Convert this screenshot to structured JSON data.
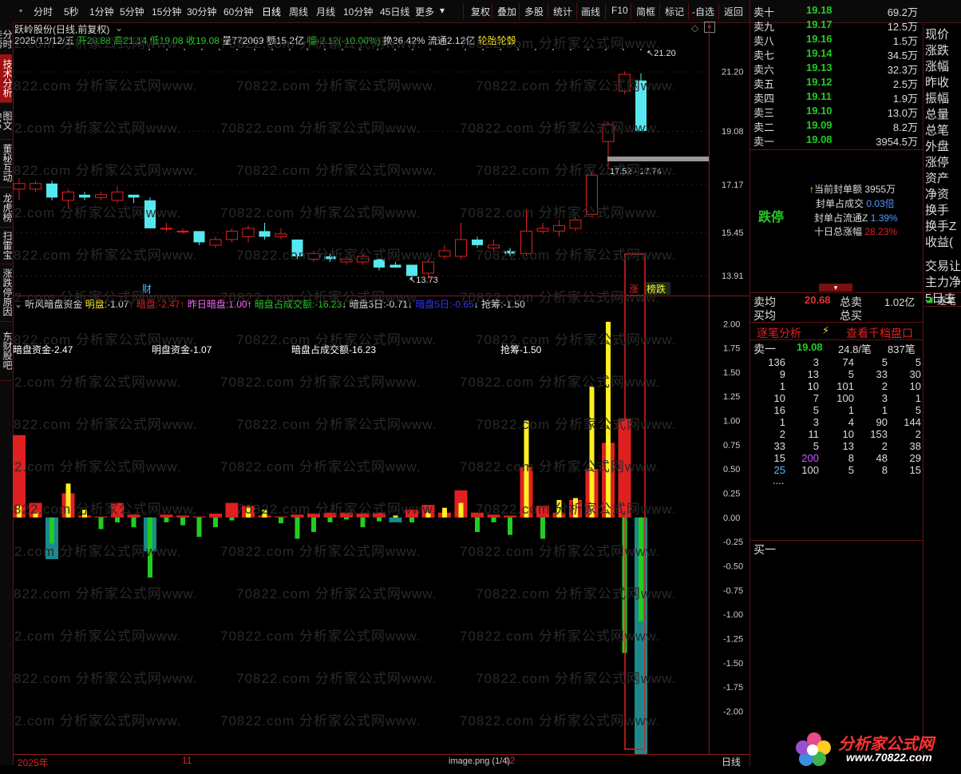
{
  "toolbar": {
    "items": [
      "分时",
      "5秒",
      "1分钟",
      "5分钟",
      "15分钟",
      "30分钟",
      "60分钟",
      "日线",
      "周线",
      "月线",
      "10分钟",
      "45日线",
      "更多"
    ],
    "right_items": [
      "复权",
      "叠加",
      "多股",
      "统计",
      "画线",
      "F10",
      "简框",
      "标记",
      "-自选",
      "返回"
    ]
  },
  "left_nav": [
    "分时走势",
    "技术分析",
    "图文F10",
    "董秘互动",
    "龙虎榜",
    "扫雷宝",
    "涨跌停原因",
    "东财股吧"
  ],
  "main": {
    "stock_title": "跃岭股份(日线,前复权)",
    "date": "2025/12/12/五",
    "open_label": "开",
    "open": "20.88",
    "high_label": "高",
    "high": "21.14",
    "low_label": "低",
    "low": "19.08",
    "close_label": "收",
    "close": "19.08",
    "vol_label": "量",
    "vol": "772069",
    "amt_label": "额",
    "amt": "15.2亿",
    "chg_label": "幅",
    "chg": "-2.12(-10.00%)",
    "turn": "换36.42%",
    "float": "流通2.12亿",
    "concept": "轮胎轮毂",
    "y_ticks": [
      "21.20",
      "19.08",
      "17.17",
      "15.45",
      "13.91"
    ],
    "high_marker": "21.20",
    "low_marker": "13.73",
    "range_label": "17.52 - 17.74",
    "cai_label": "财",
    "zhang_label": "涨",
    "bang_label": "榜跌"
  },
  "sub": {
    "indicator_name": "听风暗盘资金",
    "ming_label": "明盘:",
    "ming": "-1.07",
    "an_label": "暗盘:",
    "an": "-2.47",
    "zr_label": "昨日暗盘:",
    "zr": "1.00",
    "ancj_label": "暗盘占成交额:",
    "ancj": "-16.23",
    "an3_label": "暗盘3日:",
    "an3": "-0.71",
    "an5_label": "暗盘5日:",
    "an5": "-0.65",
    "qc_label": "抢筹:",
    "qc": "-1.50",
    "text1": "暗盘资金-2.47",
    "text2": "明盘资金-1.07",
    "text3": "暗盘占成交额-16.23",
    "text4": "抢筹-1.50",
    "y_ticks": [
      "2.00",
      "1.75",
      "1.50",
      "1.25",
      "1.00",
      "0.75",
      "0.50",
      "0.25",
      "0.00",
      "-0.25",
      "-0.50",
      "-0.75",
      "-1.00",
      "-1.25",
      "-1.50",
      "-1.75",
      "-2.00"
    ]
  },
  "bottom": {
    "year": "2025年",
    "m11": "11",
    "m12": "12",
    "filename": "image.png (1/4)",
    "period": "日线"
  },
  "orderbook": {
    "sells": [
      {
        "label": "卖十",
        "price": "19.18",
        "vol": "69.2万"
      },
      {
        "label": "卖九",
        "price": "19.17",
        "vol": "12.5万"
      },
      {
        "label": "卖八",
        "price": "19.16",
        "vol": "1.5万"
      },
      {
        "label": "卖七",
        "price": "19.14",
        "vol": "34.5万"
      },
      {
        "label": "卖六",
        "price": "19.13",
        "vol": "32.3万"
      },
      {
        "label": "卖五",
        "price": "19.12",
        "vol": "2.5万"
      },
      {
        "label": "卖四",
        "price": "19.11",
        "vol": "1.9万"
      },
      {
        "label": "卖三",
        "price": "19.10",
        "vol": "13.0万"
      },
      {
        "label": "卖二",
        "price": "19.09",
        "vol": "8.2万"
      },
      {
        "label": "卖一",
        "price": "19.08",
        "vol": "3954.5万"
      }
    ],
    "fengdan_label": "当前封单额",
    "fengdan": "3955万",
    "fdcj_label": "封单占成交",
    "fdcj": "0.03倍",
    "fdlt_label": "封单占流通Z",
    "fdlt": "1.39%",
    "sr_label": "十日总涨幅",
    "sr": "28.23%",
    "status": "跌停",
    "maijun_label": "卖均",
    "maijun": "20.68",
    "zongmai_label": "总卖",
    "zongmai": "1.02亿",
    "buyjun_label": "买均",
    "zongbuy_label": "总买",
    "tab1": "逐笔分析",
    "tab2": "查看千档盘口",
    "sell1_label": "卖一",
    "sell1_price": "19.08",
    "sell1_vol": "24.8/笔",
    "sell1_cnt": "837笔",
    "grid": [
      [
        "136",
        "3",
        "74",
        "5",
        "5"
      ],
      [
        "9",
        "13",
        "5",
        "33",
        "30"
      ],
      [
        "1",
        "10",
        "101",
        "2",
        "10"
      ],
      [
        "10",
        "7",
        "100",
        "3",
        "1"
      ],
      [
        "16",
        "5",
        "1",
        "1",
        "5"
      ],
      [
        "1",
        "3",
        "4",
        "90",
        "144"
      ],
      [
        "2",
        "11",
        "10",
        "153",
        "2"
      ],
      [
        "33",
        "5",
        "13",
        "2",
        "38"
      ],
      [
        "15",
        "200",
        "8",
        "48",
        "29"
      ],
      [
        "25",
        "100",
        "5",
        "8",
        "15"
      ]
    ],
    "dots": "....",
    "buy1_label": "买一"
  },
  "far_right": [
    "现价",
    "涨跌",
    "涨幅",
    "昨收",
    "振幅",
    "总量",
    "总笔",
    "外盘",
    "涨停",
    "资产",
    "净资",
    "换手",
    "换手Z",
    "收益(",
    "交易让",
    "主力净",
    "5日主"
  ],
  "far_right_bottom": "逐笔",
  "logo": {
    "text": "分析家公式网",
    "url": "www.70822.com"
  },
  "watermark": "70822.com 分析家公式网www.",
  "colors": {
    "up": "#e02020",
    "down": "#55e8f0",
    "green": "#22cc22",
    "yellow": "#ffee22",
    "teal": "#1b8a8c"
  },
  "chart_data": [
    {
      "type": "candlestick",
      "title": "跃岭股份(日线,前复权)",
      "y_ticks": [
        21.2,
        19.08,
        17.17,
        15.45,
        13.91
      ],
      "ylim": [
        13.2,
        22.1
      ],
      "candles": [
        {
          "o": 17.0,
          "c": 17.2,
          "h": 17.4,
          "l": 16.6
        },
        {
          "o": 17.0,
          "c": 17.2,
          "h": 17.3,
          "l": 16.9
        },
        {
          "o": 17.2,
          "c": 16.7,
          "h": 17.3,
          "l": 16.6
        },
        {
          "o": 16.6,
          "c": 16.9,
          "h": 17.0,
          "l": 16.3
        },
        {
          "o": 16.8,
          "c": 16.7,
          "h": 16.9,
          "l": 16.6
        },
        {
          "o": 16.7,
          "c": 16.8,
          "h": 16.9,
          "l": 16.6
        },
        {
          "o": 16.6,
          "c": 16.9,
          "h": 17.1,
          "l": 16.5
        },
        {
          "o": 16.8,
          "c": 16.7,
          "h": 16.8,
          "l": 16.5
        },
        {
          "o": 16.6,
          "c": 15.6,
          "h": 16.7,
          "l": 15.6
        },
        {
          "o": 15.6,
          "c": 15.6,
          "h": 15.8,
          "l": 15.5
        },
        {
          "o": 15.5,
          "c": 15.5,
          "h": 15.6,
          "l": 15.4
        },
        {
          "o": 15.5,
          "c": 15.1,
          "h": 15.5,
          "l": 15.0
        },
        {
          "o": 15.0,
          "c": 15.2,
          "h": 15.3,
          "l": 14.9
        },
        {
          "o": 15.2,
          "c": 15.5,
          "h": 15.6,
          "l": 15.1
        },
        {
          "o": 15.3,
          "c": 15.6,
          "h": 15.7,
          "l": 15.1
        },
        {
          "o": 15.5,
          "c": 15.3,
          "h": 15.8,
          "l": 15.2
        },
        {
          "o": 15.3,
          "c": 15.4,
          "h": 15.6,
          "l": 15.2
        },
        {
          "o": 15.2,
          "c": 14.6,
          "h": 15.2,
          "l": 14.5
        },
        {
          "o": 14.5,
          "c": 14.7,
          "h": 14.8,
          "l": 14.4
        },
        {
          "o": 14.6,
          "c": 14.5,
          "h": 14.7,
          "l": 14.4
        },
        {
          "o": 14.4,
          "c": 14.5,
          "h": 14.6,
          "l": 14.3
        },
        {
          "o": 14.4,
          "c": 14.6,
          "h": 14.7,
          "l": 14.3
        },
        {
          "o": 14.5,
          "c": 14.2,
          "h": 14.5,
          "l": 14.1
        },
        {
          "o": 14.3,
          "c": 14.2,
          "h": 14.4,
          "l": 14.2
        },
        {
          "o": 14.3,
          "c": 13.9,
          "h": 14.3,
          "l": 13.73
        },
        {
          "o": 14.0,
          "c": 14.4,
          "h": 14.5,
          "l": 13.8
        },
        {
          "o": 14.6,
          "c": 14.8,
          "h": 15.0,
          "l": 14.5
        },
        {
          "o": 14.6,
          "c": 15.2,
          "h": 15.8,
          "l": 14.5
        },
        {
          "o": 15.2,
          "c": 15.0,
          "h": 15.3,
          "l": 14.9
        },
        {
          "o": 14.9,
          "c": 15.0,
          "h": 15.2,
          "l": 14.8
        },
        {
          "o": 14.8,
          "c": 14.7,
          "h": 14.9,
          "l": 14.6
        },
        {
          "o": 14.7,
          "c": 15.5,
          "h": 16.3,
          "l": 14.6
        },
        {
          "o": 15.5,
          "c": 15.6,
          "h": 15.8,
          "l": 15.4
        },
        {
          "o": 15.5,
          "c": 15.7,
          "h": 15.9,
          "l": 15.3
        },
        {
          "o": 15.6,
          "c": 15.9,
          "h": 16.0,
          "l": 15.5
        },
        {
          "o": 16.1,
          "c": 17.5,
          "h": 17.6,
          "l": 16.0
        },
        {
          "o": 18.7,
          "c": 19.3,
          "h": 19.4,
          "l": 17.7
        },
        {
          "o": 20.5,
          "c": 21.1,
          "h": 21.2,
          "l": 20.4
        },
        {
          "o": 20.88,
          "c": 19.08,
          "h": 21.14,
          "l": 19.08
        }
      ]
    },
    {
      "type": "bar",
      "title": "听风暗盘资金",
      "ylim": [
        -2.45,
        2.2
      ],
      "series": [
        {
          "name": "明盘",
          "values": [
            0.12,
            0.05,
            -0.27,
            0.35,
            0.08,
            -0.12,
            -0.05,
            -0.1,
            -0.62,
            -0.05,
            -0.08,
            -0.2,
            -0.1,
            -0.03,
            0.1,
            0.08,
            -0.06,
            -0.22,
            -0.15,
            -0.05,
            -0.02,
            -0.1,
            -0.04,
            0.02,
            -0.05,
            0.05,
            0.1,
            0.15,
            -0.15,
            -0.05,
            -0.18,
            1.0,
            -0.22,
            0.18,
            0.2,
            1.35,
            2.02,
            -1.4,
            -1.07
          ]
        },
        {
          "name": "暗盘",
          "values": [
            0.85,
            0.15,
            -0.43,
            0.25,
            0.02,
            0.01,
            0.15,
            0.03,
            -0.35,
            0.03,
            0.02,
            0.01,
            0.04,
            0.15,
            0.12,
            0.02,
            0.01,
            0.03,
            0.04,
            0.05,
            0.05,
            0.04,
            0.05,
            -0.05,
            0.08,
            0.13,
            0.05,
            0.28,
            0.05,
            0.03,
            0.02,
            0.52,
            0.12,
            0.05,
            0.18,
            0.5,
            0.77,
            1.02,
            -2.47
          ]
        }
      ]
    }
  ]
}
